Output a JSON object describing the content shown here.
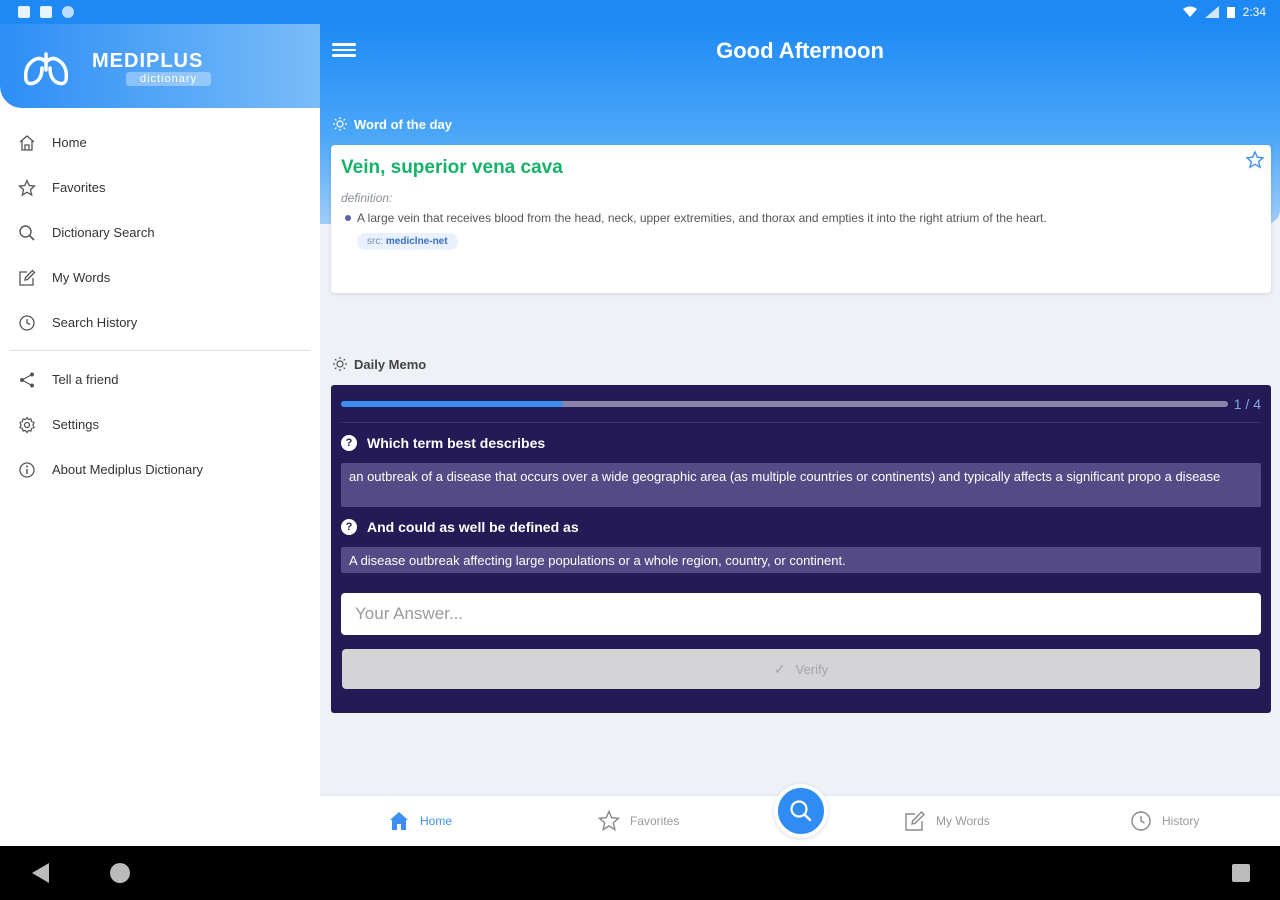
{
  "status_bar": {
    "time": "2:34"
  },
  "header": {
    "greeting": "Good Afternoon"
  },
  "brand": {
    "name": "MEDIPLUS",
    "subtitle": "dictionary"
  },
  "sidebar": {
    "items": [
      {
        "label": "Home",
        "icon": "home-icon"
      },
      {
        "label": "Favorites",
        "icon": "star-icon"
      },
      {
        "label": "Dictionary Search",
        "icon": "search-icon"
      },
      {
        "label": "My Words",
        "icon": "edit-icon"
      },
      {
        "label": "Search History",
        "icon": "history-icon"
      }
    ],
    "secondary": [
      {
        "label": "Tell a friend",
        "icon": "share-icon"
      },
      {
        "label": "Settings",
        "icon": "gear-icon"
      },
      {
        "label": "About Mediplus Dictionary",
        "icon": "info-icon"
      }
    ]
  },
  "word_of_day": {
    "section_label": "Word of the day",
    "title": "Vein, superior vena cava",
    "definition_label": "definition:",
    "definition": "A large vein that receives blood from the head, neck, upper extremities, and  thorax and empties it into the right atrium of the heart.",
    "source_prefix": "src:",
    "source": "mediclne-net"
  },
  "daily_memo": {
    "section_label": "Daily Memo",
    "progress": {
      "current": 1,
      "total": 4,
      "text": "1 / 4"
    },
    "question_1": "Which term best describes",
    "answer_1": "an outbreak of a disease that occurs over a wide geographic area (as multiple countries or continents) and typically affects a significant propo a disease",
    "question_2": "And could as well be defined as",
    "answer_2": "A disease outbreak affecting large populations or a whole region, country, or continent.",
    "input_placeholder": "Your Answer...",
    "verify_label": "Verify"
  },
  "bottom_nav": {
    "home": "Home",
    "favorites": "Favorites",
    "my_words": "My Words",
    "history": "History"
  },
  "colors": {
    "primary": "#1e88f5",
    "accent_green": "#17b26a",
    "memo_bg": "#241a56",
    "memo_answer_bg": "#544a85"
  }
}
